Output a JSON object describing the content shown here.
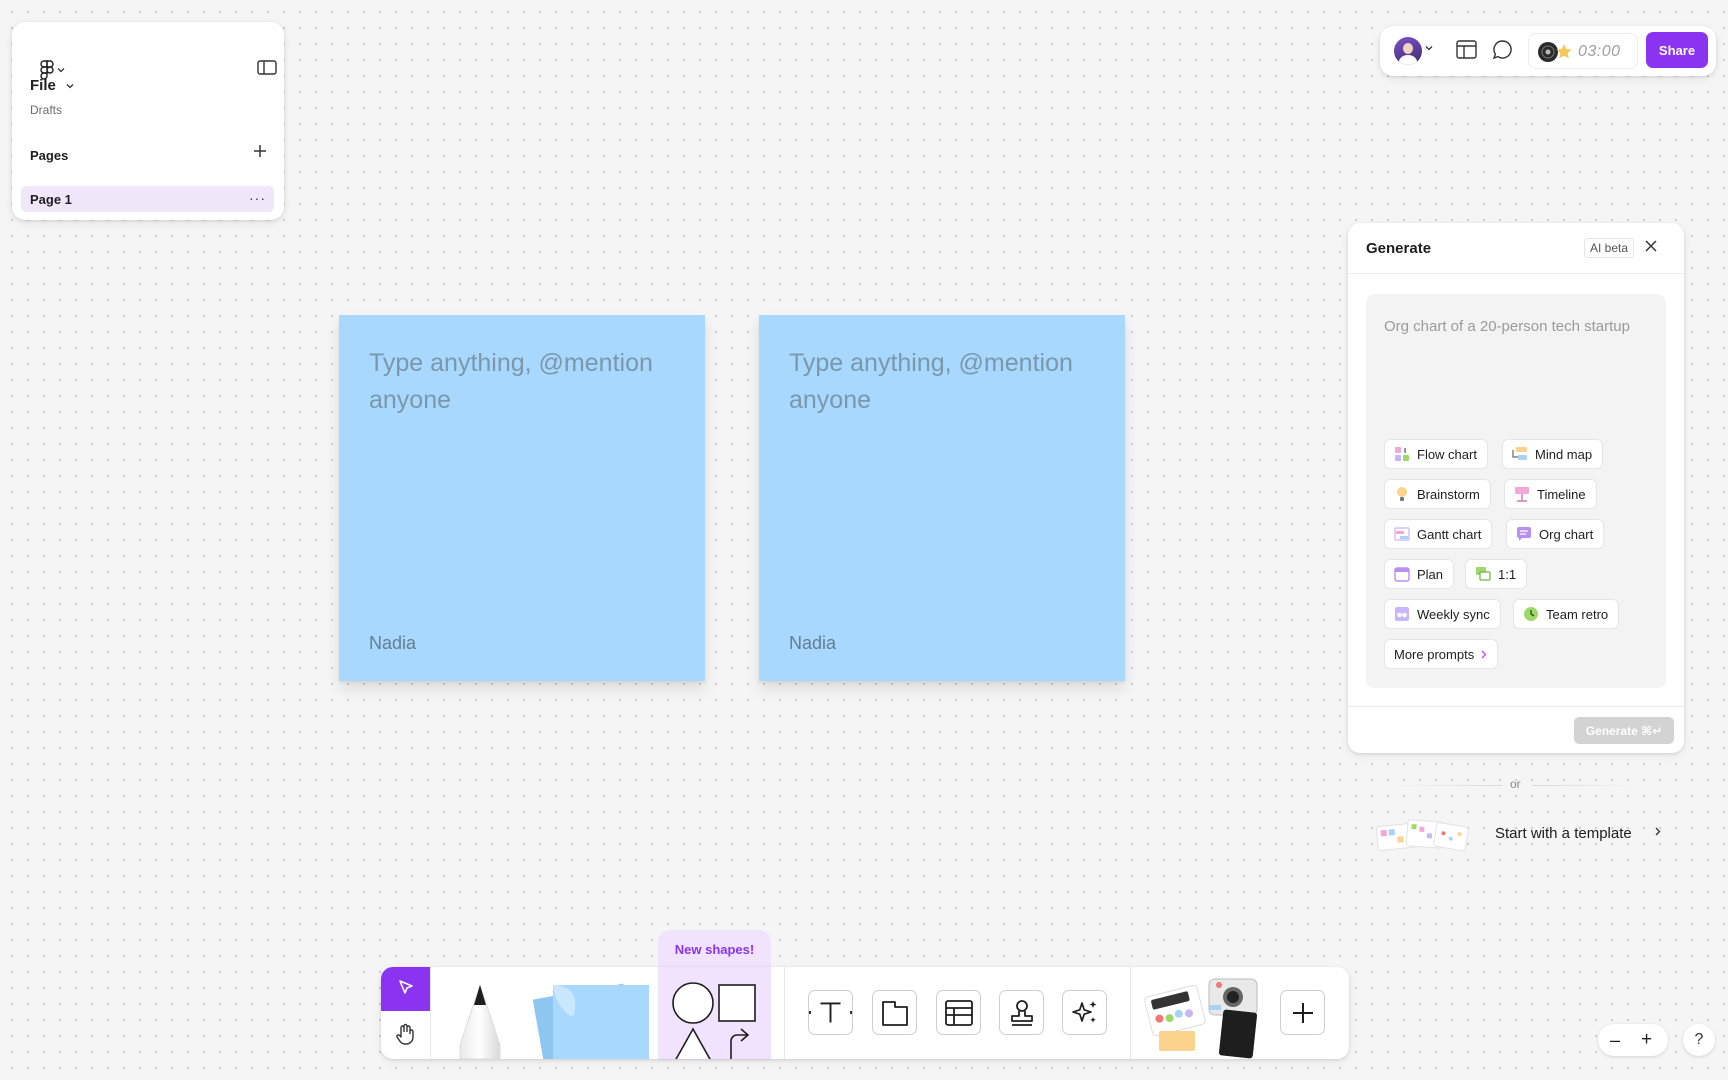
{
  "file_panel": {
    "file_label": "File",
    "location": "Drafts",
    "pages_title": "Pages",
    "pages": [
      {
        "label": "Page 1",
        "more": "···"
      }
    ]
  },
  "top_bar": {
    "timer": "03:00",
    "share_label": "Share"
  },
  "stickies": [
    {
      "placeholder": "Type anything, @mention anyone",
      "author": "Nadia",
      "color": "#a8d8fd"
    },
    {
      "placeholder": "Type anything, @mention anyone",
      "author": "Nadia",
      "color": "#a8d8fd"
    }
  ],
  "generate_panel": {
    "title": "Generate",
    "badge": "AI beta",
    "prompt_placeholder": "Org chart of a 20-person tech startup",
    "chips": [
      {
        "label": "Flow chart",
        "icon": "flow-chart-icon"
      },
      {
        "label": "Mind map",
        "icon": "mind-map-icon"
      },
      {
        "label": "Brainstorm",
        "icon": "lightbulb-icon"
      },
      {
        "label": "Timeline",
        "icon": "timeline-icon"
      },
      {
        "label": "Gantt chart",
        "icon": "gantt-chart-icon"
      },
      {
        "label": "Org chart",
        "icon": "org-chart-icon"
      },
      {
        "label": "Plan",
        "icon": "calendar-icon"
      },
      {
        "label": "1:1",
        "icon": "chat-bubbles-icon"
      },
      {
        "label": "Weekly sync",
        "icon": "weekly-sync-icon"
      },
      {
        "label": "Team retro",
        "icon": "clock-icon"
      },
      {
        "label": "More prompts",
        "icon": "chevron-right-icon"
      }
    ],
    "generate_label": "Generate ⌘↵"
  },
  "or_text": "or",
  "template_link": "Start with a template",
  "toolbar": {
    "new_shapes_label": "New shapes!",
    "accent": "#8a34f2"
  },
  "zoom": {
    "minus": "–",
    "plus": "+"
  },
  "help": "?"
}
